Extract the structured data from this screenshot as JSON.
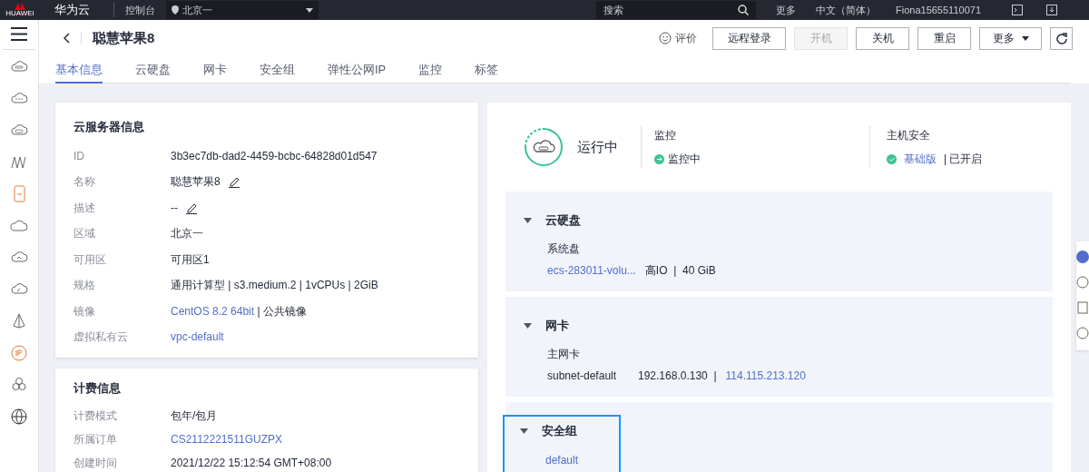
{
  "top_bar": {
    "brand": "华为云",
    "logo_text": "HUAWEI",
    "console": "控制台",
    "region": "北京一",
    "search_placeholder": "搜索",
    "links": [
      "更多",
      "中文（简体）",
      "Fiona15655110071"
    ]
  },
  "header": {
    "title": "聪慧苹果8",
    "rate": "评价",
    "buttons": [
      {
        "label": "远程登录",
        "disabled": false,
        "kind": "plain"
      },
      {
        "label": "开机",
        "disabled": true,
        "kind": "plain"
      },
      {
        "label": "关机",
        "disabled": false,
        "kind": "plain"
      },
      {
        "label": "重启",
        "disabled": false,
        "kind": "plain"
      },
      {
        "label": "更多",
        "disabled": false,
        "kind": "dropdown"
      },
      {
        "kind": "refresh"
      }
    ]
  },
  "tabs": [
    {
      "label": "基本信息",
      "selected": true
    },
    {
      "label": "云硬盘",
      "selected": false
    },
    {
      "label": "网卡",
      "selected": false
    },
    {
      "label": "安全组",
      "selected": false
    },
    {
      "label": "弹性公网IP",
      "selected": false
    },
    {
      "label": "监控",
      "selected": false
    },
    {
      "label": "标签",
      "selected": false
    }
  ],
  "server_info": {
    "title": "云服务器信息",
    "rows": [
      {
        "label": "ID",
        "value": "3b3ec7db-dad2-4459-bcbc-64828d01d547",
        "kind": "text"
      },
      {
        "label": "名称",
        "value": "聪慧苹果8",
        "kind": "editable"
      },
      {
        "label": "描述",
        "value": "--",
        "kind": "editable"
      },
      {
        "label": "区域",
        "value": "北京一",
        "kind": "text"
      },
      {
        "label": "可用区",
        "value": "可用区1",
        "kind": "text"
      },
      {
        "label": "规格",
        "value": "通用计算型 | s3.medium.2 | 1vCPUs | 2GiB",
        "kind": "text"
      },
      {
        "label": "镜像",
        "link": "CentOS 8.2 64bit",
        "value": " | 公共镜像",
        "kind": "link"
      },
      {
        "label": "虚拟私有云",
        "link": "vpc-default",
        "kind": "link"
      }
    ]
  },
  "billing_info": {
    "title": "计费信息",
    "rows": [
      {
        "label": "计费模式",
        "value": "包年/包月",
        "kind": "text"
      },
      {
        "label": "所属订单",
        "link": "CS2112221511GUZPX",
        "kind": "link"
      },
      {
        "label": "创建时间",
        "value": "2021/12/22 15:12:54 GMT+08:00",
        "kind": "text"
      }
    ]
  },
  "status": {
    "state": "运行中",
    "monitor_label": "监控",
    "monitor_value": "监控中",
    "security_label": "主机安全",
    "security_link": "基础版",
    "security_value": "| 已开启"
  },
  "sections": [
    {
      "title": "云硬盘",
      "expanded": true,
      "selected": false,
      "subtitle": "系统盘",
      "items": [
        {
          "text": "ecs-283011-volu...",
          "kind": "link"
        },
        {
          "text": "高IO  |  40 GiB",
          "kind": "text"
        }
      ]
    },
    {
      "title": "网卡",
      "expanded": true,
      "selected": false,
      "subtitle": "主网卡",
      "items": [
        {
          "text": "subnet-default",
          "kind": "text"
        },
        {
          "text": "192.168.0.130  |",
          "kind": "text"
        },
        {
          "text": "114.115.213.120",
          "kind": "link"
        }
      ]
    },
    {
      "title": "安全组",
      "expanded": true,
      "selected": true,
      "items": [
        {
          "text": "default",
          "kind": "link"
        }
      ]
    }
  ]
}
